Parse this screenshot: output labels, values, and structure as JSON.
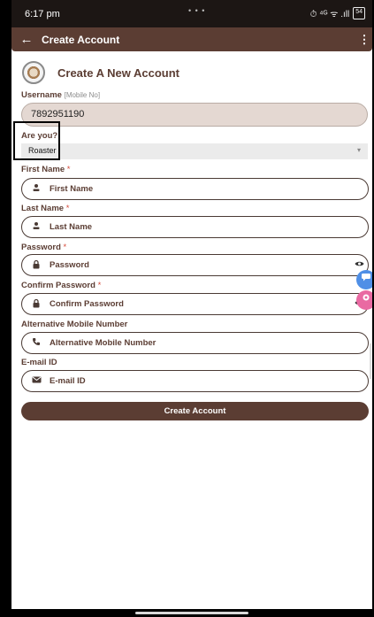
{
  "status_bar": {
    "time": "6:17 pm",
    "dots": "• • •",
    "icons": "⏱ ⁴ᴳ ᯤ .ıll",
    "battery": "54"
  },
  "app_bar": {
    "back_icon": "←",
    "title": "Create Account",
    "more_icon": "⋮"
  },
  "header": {
    "title": "Create A New Account"
  },
  "username": {
    "label": "Username",
    "sublabel": "[Mobile No]",
    "value": "7892951190"
  },
  "role": {
    "label": "Are you?",
    "selected": "Roaster",
    "arrow": "▾"
  },
  "fields": {
    "first_name": {
      "label": "First Name",
      "required": " *",
      "placeholder": "First Name",
      "icon": "person-icon"
    },
    "last_name": {
      "label": "Last Name",
      "required": " *",
      "placeholder": "Last Name",
      "icon": "person-icon"
    },
    "password": {
      "label": "Password",
      "required": " *",
      "placeholder": "Password",
      "icon": "lock-icon"
    },
    "confirm_password": {
      "label": "Confirm Password",
      "required": " *",
      "placeholder": "Confirm Password",
      "icon": "lock-icon"
    },
    "alt_mobile": {
      "label": "Alternative Mobile Number",
      "placeholder": "Alternative Mobile Number",
      "icon": "phone-icon"
    },
    "email": {
      "label": "E-mail ID",
      "placeholder": "E-mail ID",
      "icon": "mail-icon"
    }
  },
  "create_button": {
    "label": "Create Account"
  },
  "colors": {
    "primary": "#5b3d33",
    "required": "#d54a3a",
    "username_bg": "#e4d8d2"
  }
}
